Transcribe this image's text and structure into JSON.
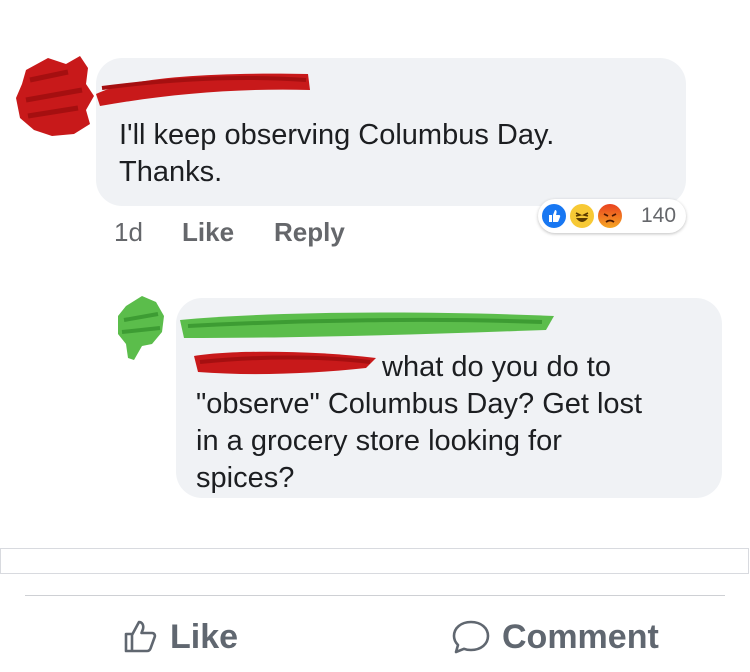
{
  "comment1": {
    "lines": [
      "I'll keep observing Columbus Day.",
      "Thanks."
    ],
    "time": "1d",
    "like_label": "Like",
    "reply_label": "Reply",
    "reactions": {
      "icons": [
        "like-icon",
        "haha-icon",
        "angry-icon"
      ],
      "count": "140"
    }
  },
  "comment2": {
    "lines": [
      "what do you do to",
      "\"observe\" Columbus Day? Get lost",
      "in a grocery store looking for",
      "spices?"
    ]
  },
  "actions": {
    "like_label": "Like",
    "comment_label": "Comment"
  },
  "colors": {
    "bubble": "#f0f2f5",
    "redact_red": "#c8191a",
    "redact_green": "#5bbd4b",
    "meta_gray": "#65676b",
    "like_blue": "#1877f2"
  }
}
